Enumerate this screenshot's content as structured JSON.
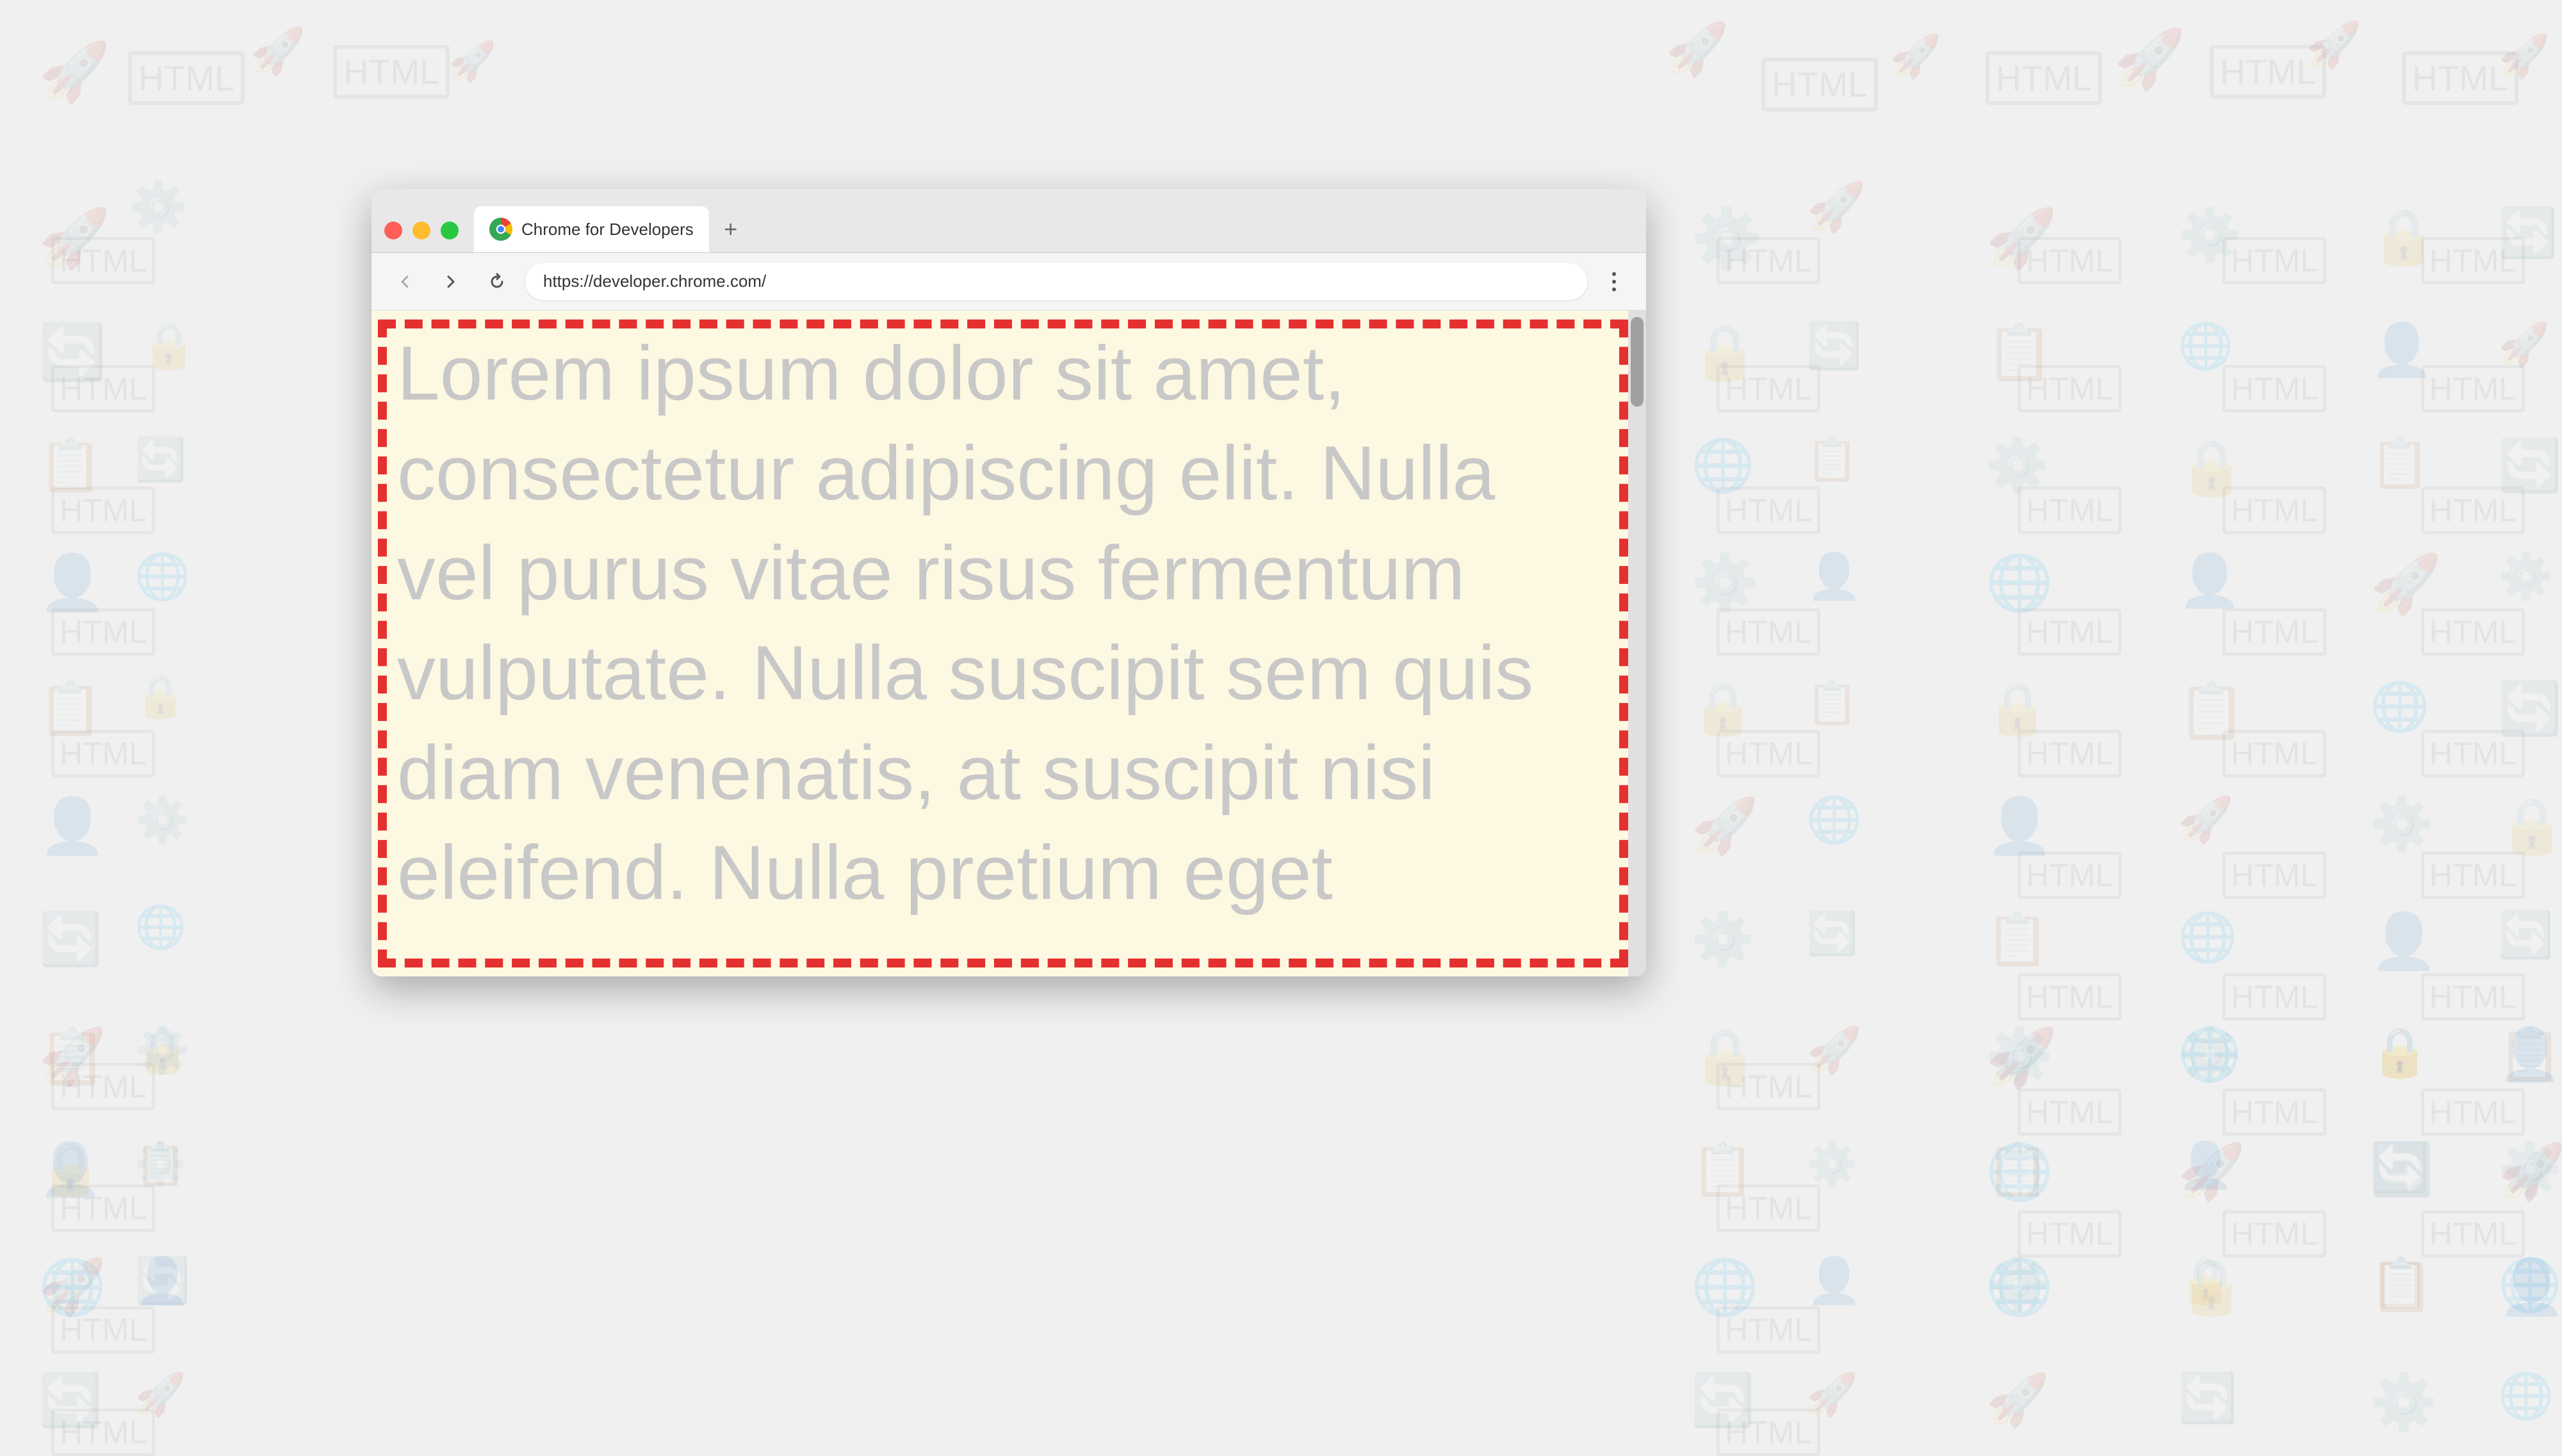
{
  "background": {
    "color": "#f0f0f0"
  },
  "browser": {
    "window_title": "Chrome for Developers",
    "tab_title": "Chrome for Developers",
    "url": "https://developer.chrome.com/",
    "new_tab_label": "+",
    "nav": {
      "back_label": "←",
      "forward_label": "→",
      "reload_label": "↻"
    },
    "menu_label": "⋮"
  },
  "page": {
    "background_color": "#fdf8e1",
    "border_color": "#e53030",
    "text_color": "#c8c8c8",
    "lorem_text": "Lorem ipsum dolor sit amet, consectetur adipiscing elit. Nulla vel purus vitae risus fermentum vulputate. Nulla suscipit sem quis diam venenatis, at suscipit nisi eleifend. Nulla pretium eget"
  }
}
